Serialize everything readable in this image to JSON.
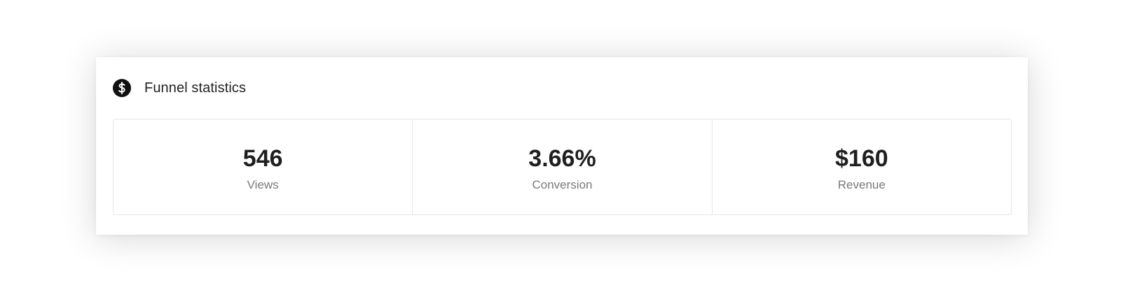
{
  "card": {
    "title": "Funnel statistics",
    "icon": "dollar-circle-icon"
  },
  "stats": [
    {
      "value": "546",
      "label": "Views"
    },
    {
      "value": "3.66%",
      "label": "Conversion"
    },
    {
      "value": "$160",
      "label": "Revenue"
    }
  ],
  "colors": {
    "icon_bg": "#111111",
    "value_text": "#1f1f1f",
    "label_text": "#7a7a7a",
    "border": "#e6e6e6"
  }
}
